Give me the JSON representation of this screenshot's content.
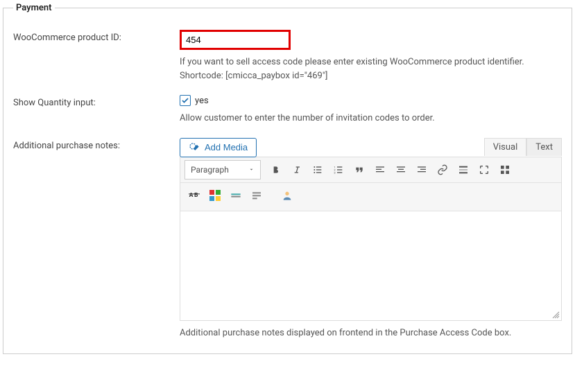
{
  "section": {
    "title": "Payment"
  },
  "product_id": {
    "label": "WooCommerce product ID:",
    "value": "454",
    "help1": "If you want to sell access code please enter existing WooCommerce product identifier.",
    "help2": "Shortcode: [cmicca_paybox id=\"469\"]"
  },
  "quantity": {
    "label": "Show Quantity input:",
    "checkbox_label": "yes",
    "help": "Allow customer to enter the number of invitation codes to order."
  },
  "notes": {
    "label": "Additional purchase notes:",
    "add_media": "Add Media",
    "tab_visual": "Visual",
    "tab_text": "Text",
    "format_select": "Paragraph",
    "help": "Additional purchase notes displayed on frontend in the Purchase Access Code box."
  }
}
